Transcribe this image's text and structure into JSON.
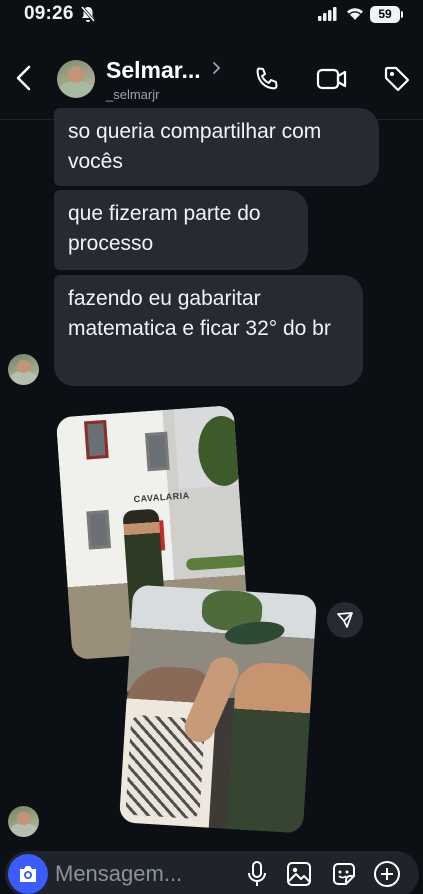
{
  "status_bar": {
    "time": "09:26",
    "battery": "59"
  },
  "header": {
    "name": "Selmar...",
    "handle": "_selmarjr"
  },
  "messages": [
    {
      "text": "so queria compartilhar com vocês"
    },
    {
      "text": "que fizeram parte do processo"
    },
    {
      "text": "fazendo eu gabaritar matematica e ficar 32° do br"
    }
  ],
  "photos": {
    "photo1_sign": "CAVALARIA"
  },
  "composer": {
    "placeholder": "Mensagem..."
  },
  "icons": {
    "back": "back-chevron-icon",
    "call": "phone-icon",
    "video": "video-camera-icon",
    "tag": "tag-icon",
    "share": "send-icon",
    "camera": "camera-icon",
    "mic": "microphone-icon",
    "gallery": "gallery-icon",
    "sticker": "sticker-icon",
    "add": "plus-icon"
  },
  "colors": {
    "accent": "#3b5bfd",
    "bubble": "#262a32",
    "background": "#0c0f14"
  }
}
